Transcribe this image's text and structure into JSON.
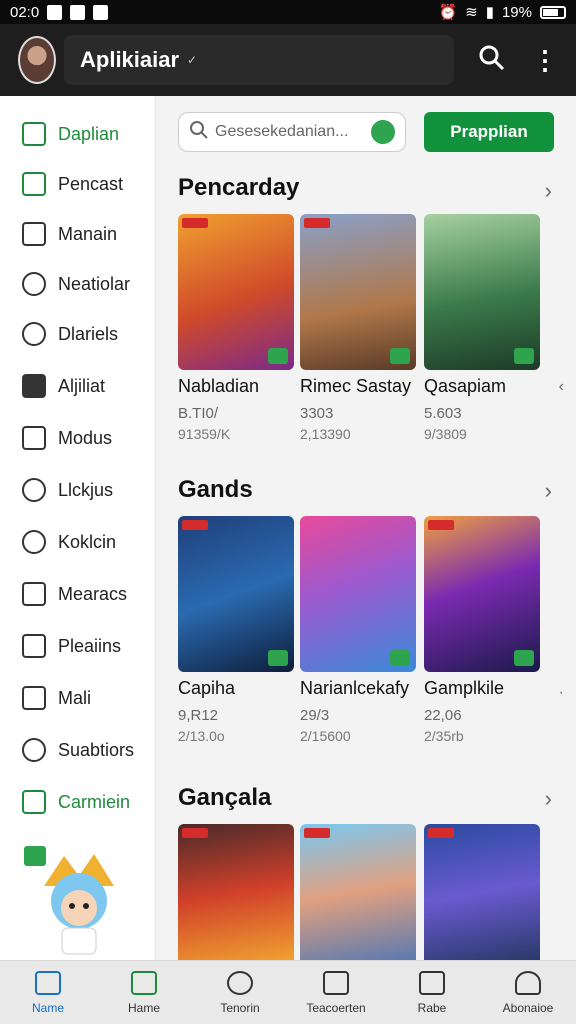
{
  "status_bar": {
    "time": "02:0",
    "battery": "19%"
  },
  "app_bar": {
    "account_name": "Aplikiaiar"
  },
  "colors": {
    "accent_green": "#12913d",
    "active_blue": "#1a6fc6",
    "appbar_bg": "#1e1e1e"
  },
  "sidebar": {
    "items": [
      {
        "label": "Daplian",
        "icon": "app-icon"
      },
      {
        "label": "Pencast",
        "icon": "cast-icon"
      },
      {
        "label": "Manain",
        "icon": "camera-icon"
      },
      {
        "label": "Neatiolar",
        "icon": "chat-icon"
      },
      {
        "label": "Dlariels",
        "icon": "comment-icon"
      },
      {
        "label": "Aljiliat",
        "icon": "gamepad-icon"
      },
      {
        "label": "Modus",
        "icon": "square-icon"
      },
      {
        "label": "Llckjus",
        "icon": "cloud-icon"
      },
      {
        "label": "Koklcin",
        "icon": "power-icon"
      },
      {
        "label": "Mearacs",
        "icon": "card-icon"
      },
      {
        "label": "Pleaiins",
        "icon": "list-icon"
      },
      {
        "label": "Mali",
        "icon": "mail-icon"
      },
      {
        "label": "Suabtiors",
        "icon": "search-icon"
      },
      {
        "label": "Carmiein",
        "icon": "tools-icon"
      }
    ]
  },
  "search": {
    "placeholder": "Gesesekedanian..."
  },
  "primary_button": {
    "label": "Prapplian"
  },
  "sections": [
    {
      "title": "Pencarday",
      "cards": [
        {
          "name": "Nabladian",
          "line1": "B.TI0/",
          "line2": "91359/K"
        },
        {
          "name": "Rimec Sastay",
          "line1": "3303",
          "line2": "2,13390"
        },
        {
          "name": "Qasapiam",
          "line1": "5.603",
          "line2": "9/3809"
        }
      ]
    },
    {
      "title": "Gands",
      "cards": [
        {
          "name": "Capiha",
          "line1": "9,R12",
          "line2": "2/13.0o"
        },
        {
          "name": "Narianlcekafy",
          "line1": "29/3",
          "line2": "2/15600"
        },
        {
          "name": "Gamplkile",
          "line1": "22,06",
          "line2": "2/35rb"
        }
      ]
    },
    {
      "title": "Gançala"
    }
  ],
  "bottom_nav": [
    {
      "label": "Name",
      "icon": "home-icon"
    },
    {
      "label": "Hame",
      "icon": "games-icon"
    },
    {
      "label": "Tenorin",
      "icon": "clock-icon"
    },
    {
      "label": "Teacoerten",
      "icon": "edit-icon"
    },
    {
      "label": "Rabe",
      "icon": "notes-icon"
    },
    {
      "label": "Abonaioe",
      "icon": "profile-icon"
    }
  ]
}
